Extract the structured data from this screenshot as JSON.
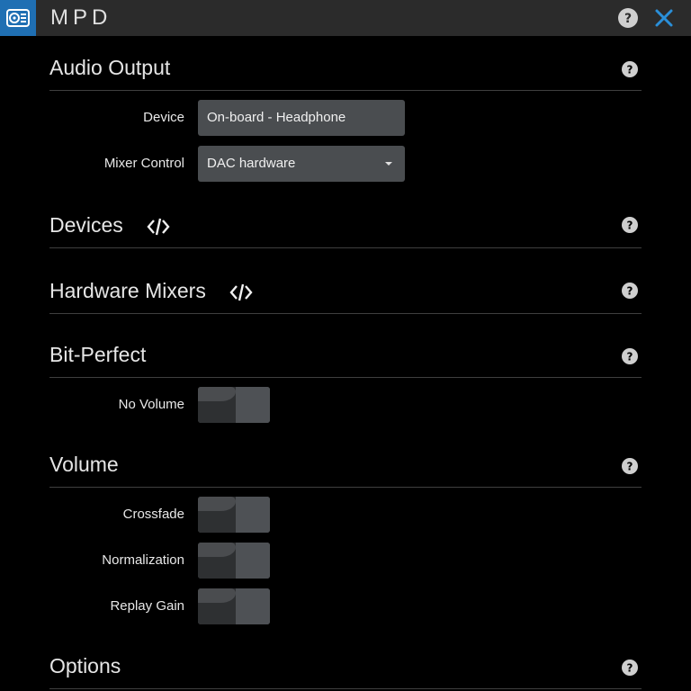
{
  "titlebar": {
    "title": "MPD",
    "app_icon": "moode-app-icon",
    "help_icon": "help-circle-icon",
    "close_icon": "close-icon"
  },
  "audio_output": {
    "title": "Audio Output",
    "device_label": "Device",
    "device_value": "On-board - Headphone",
    "mixer_label": "Mixer Control",
    "mixer_value": "DAC hardware"
  },
  "devices": {
    "title": "Devices"
  },
  "hardware_mixers": {
    "title": "Hardware Mixers"
  },
  "bit_perfect": {
    "title": "Bit-Perfect",
    "no_volume_label": "No Volume",
    "no_volume_on": false
  },
  "volume": {
    "title": "Volume",
    "crossfade_label": "Crossfade",
    "crossfade_on": false,
    "normalization_label": "Normalization",
    "normalization_on": false,
    "replay_gain_label": "Replay Gain",
    "replay_gain_on": false
  },
  "options": {
    "title": "Options"
  },
  "colors": {
    "accent": "#1f6fb3",
    "close_icon": "#2a8fd8",
    "background": "#000000",
    "field": "#4a4d50"
  }
}
